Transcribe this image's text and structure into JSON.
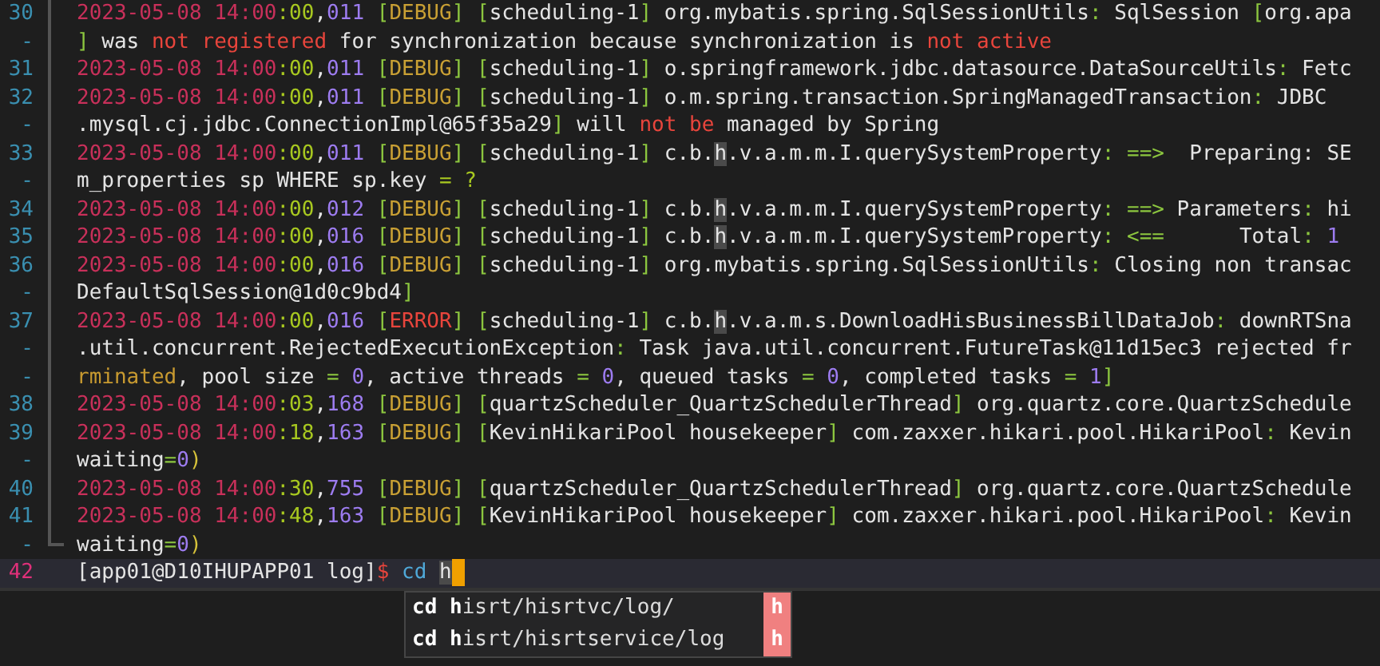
{
  "terminal": {
    "rows": [
      {
        "number": "30",
        "current": false,
        "segments": [
          {
            "kind": "date",
            "text": "2023-05-08 14:00"
          },
          {
            "kind": "sec",
            "text": ":00"
          },
          {
            "kind": "text",
            "text": ","
          },
          {
            "kind": "num",
            "text": "011"
          },
          {
            "kind": "br",
            "text": " ["
          },
          {
            "kind": "level",
            "text": "DEBUG"
          },
          {
            "kind": "br",
            "text": "]"
          },
          {
            "kind": "br",
            "text": " ["
          },
          {
            "kind": "text",
            "text": "scheduling-1"
          },
          {
            "kind": "br",
            "text": "]"
          },
          {
            "kind": "text",
            "text": " org.mybatis.spring.SqlSessionUtils"
          },
          {
            "kind": "br",
            "text": ":"
          },
          {
            "kind": "text",
            "text": " SqlSession"
          },
          {
            "kind": "br",
            "text": " ["
          },
          {
            "kind": "text",
            "text": "org.apa"
          }
        ]
      },
      {
        "number": "-",
        "current": false,
        "segments": [
          {
            "kind": "br",
            "text": "]"
          },
          {
            "kind": "text",
            "text": " was"
          },
          {
            "kind": "kw",
            "text": " not registered"
          },
          {
            "kind": "text",
            "text": " for synchronization because synchronization is"
          },
          {
            "kind": "kw",
            "text": " not active"
          }
        ]
      },
      {
        "number": "31",
        "current": false,
        "segments": [
          {
            "kind": "date",
            "text": "2023-05-08 14:00"
          },
          {
            "kind": "sec",
            "text": ":00"
          },
          {
            "kind": "text",
            "text": ","
          },
          {
            "kind": "num",
            "text": "011"
          },
          {
            "kind": "br",
            "text": " ["
          },
          {
            "kind": "level",
            "text": "DEBUG"
          },
          {
            "kind": "br",
            "text": "]"
          },
          {
            "kind": "br",
            "text": " ["
          },
          {
            "kind": "text",
            "text": "scheduling-1"
          },
          {
            "kind": "br",
            "text": "]"
          },
          {
            "kind": "text",
            "text": " o.springframework.jdbc.datasource.DataSourceUtils"
          },
          {
            "kind": "br",
            "text": ":"
          },
          {
            "kind": "text",
            "text": " Fetc"
          }
        ]
      },
      {
        "number": "32",
        "current": false,
        "segments": [
          {
            "kind": "date",
            "text": "2023-05-08 14:00"
          },
          {
            "kind": "sec",
            "text": ":00"
          },
          {
            "kind": "text",
            "text": ","
          },
          {
            "kind": "num",
            "text": "011"
          },
          {
            "kind": "br",
            "text": " ["
          },
          {
            "kind": "level",
            "text": "DEBUG"
          },
          {
            "kind": "br",
            "text": "]"
          },
          {
            "kind": "br",
            "text": " ["
          },
          {
            "kind": "text",
            "text": "scheduling-1"
          },
          {
            "kind": "br",
            "text": "]"
          },
          {
            "kind": "text",
            "text": " o.m.spring.transaction.SpringManagedTransaction"
          },
          {
            "kind": "br",
            "text": ":"
          },
          {
            "kind": "text",
            "text": " JDBC"
          }
        ]
      },
      {
        "number": "-",
        "current": false,
        "segments": [
          {
            "kind": "text",
            "text": ".mysql.cj.jdbc.ConnectionImpl@65f35a29"
          },
          {
            "kind": "br",
            "text": "]"
          },
          {
            "kind": "text",
            "text": " will"
          },
          {
            "kind": "kw",
            "text": " not be"
          },
          {
            "kind": "text",
            "text": " managed by Spring"
          }
        ]
      },
      {
        "number": "33",
        "current": false,
        "segments": [
          {
            "kind": "date",
            "text": "2023-05-08 14:00"
          },
          {
            "kind": "sec",
            "text": ":00"
          },
          {
            "kind": "text",
            "text": ","
          },
          {
            "kind": "num",
            "text": "011"
          },
          {
            "kind": "br",
            "text": " ["
          },
          {
            "kind": "level",
            "text": "DEBUG"
          },
          {
            "kind": "br",
            "text": "]"
          },
          {
            "kind": "br",
            "text": " ["
          },
          {
            "kind": "text",
            "text": "scheduling-1"
          },
          {
            "kind": "br",
            "text": "]"
          },
          {
            "kind": "text",
            "text": " c.b."
          },
          {
            "kind": "hl",
            "text": "h"
          },
          {
            "kind": "text",
            "text": ".v.a.m.m.I.querySystemProperty"
          },
          {
            "kind": "br",
            "text": ": ==>"
          },
          {
            "kind": "text",
            "text": "  Preparing: SE"
          }
        ]
      },
      {
        "number": "-",
        "current": false,
        "segments": [
          {
            "kind": "text",
            "text": "m_properties sp WHERE sp.key"
          },
          {
            "kind": "sec",
            "text": " = ?"
          }
        ]
      },
      {
        "number": "34",
        "current": false,
        "segments": [
          {
            "kind": "date",
            "text": "2023-05-08 14:00"
          },
          {
            "kind": "sec",
            "text": ":00"
          },
          {
            "kind": "text",
            "text": ","
          },
          {
            "kind": "num",
            "text": "012"
          },
          {
            "kind": "br",
            "text": " ["
          },
          {
            "kind": "level",
            "text": "DEBUG"
          },
          {
            "kind": "br",
            "text": "]"
          },
          {
            "kind": "br",
            "text": " ["
          },
          {
            "kind": "text",
            "text": "scheduling-1"
          },
          {
            "kind": "br",
            "text": "]"
          },
          {
            "kind": "text",
            "text": " c.b."
          },
          {
            "kind": "hl",
            "text": "h"
          },
          {
            "kind": "text",
            "text": ".v.a.m.m.I.querySystemProperty"
          },
          {
            "kind": "br",
            "text": ": ==>"
          },
          {
            "kind": "text",
            "text": " Parameters"
          },
          {
            "kind": "br",
            "text": ":"
          },
          {
            "kind": "text",
            "text": " hi"
          }
        ]
      },
      {
        "number": "35",
        "current": false,
        "segments": [
          {
            "kind": "date",
            "text": "2023-05-08 14:00"
          },
          {
            "kind": "sec",
            "text": ":00"
          },
          {
            "kind": "text",
            "text": ","
          },
          {
            "kind": "num",
            "text": "016"
          },
          {
            "kind": "br",
            "text": " ["
          },
          {
            "kind": "level",
            "text": "DEBUG"
          },
          {
            "kind": "br",
            "text": "]"
          },
          {
            "kind": "br",
            "text": " ["
          },
          {
            "kind": "text",
            "text": "scheduling-1"
          },
          {
            "kind": "br",
            "text": "]"
          },
          {
            "kind": "text",
            "text": " c.b."
          },
          {
            "kind": "hl",
            "text": "h"
          },
          {
            "kind": "text",
            "text": ".v.a.m.m.I.querySystemProperty"
          },
          {
            "kind": "br",
            "text": ": <=="
          },
          {
            "kind": "text",
            "text": "      Total"
          },
          {
            "kind": "br",
            "text": ":"
          },
          {
            "kind": "num",
            "text": " 1"
          }
        ]
      },
      {
        "number": "36",
        "current": false,
        "segments": [
          {
            "kind": "date",
            "text": "2023-05-08 14:00"
          },
          {
            "kind": "sec",
            "text": ":00"
          },
          {
            "kind": "text",
            "text": ","
          },
          {
            "kind": "num",
            "text": "016"
          },
          {
            "kind": "br",
            "text": " ["
          },
          {
            "kind": "level",
            "text": "DEBUG"
          },
          {
            "kind": "br",
            "text": "]"
          },
          {
            "kind": "br",
            "text": " ["
          },
          {
            "kind": "text",
            "text": "scheduling-1"
          },
          {
            "kind": "br",
            "text": "]"
          },
          {
            "kind": "text",
            "text": " org.mybatis.spring.SqlSessionUtils"
          },
          {
            "kind": "br",
            "text": ":"
          },
          {
            "kind": "text",
            "text": " Closing non transac"
          }
        ]
      },
      {
        "number": "-",
        "current": false,
        "segments": [
          {
            "kind": "text",
            "text": "DefaultSqlSession@1d0c9bd4"
          },
          {
            "kind": "br",
            "text": "]"
          }
        ]
      },
      {
        "number": "37",
        "current": false,
        "segments": [
          {
            "kind": "date",
            "text": "2023-05-08 14:00"
          },
          {
            "kind": "sec",
            "text": ":00"
          },
          {
            "kind": "text",
            "text": ","
          },
          {
            "kind": "num",
            "text": "016"
          },
          {
            "kind": "br",
            "text": " ["
          },
          {
            "kind": "error",
            "text": "ERROR"
          },
          {
            "kind": "br",
            "text": "]"
          },
          {
            "kind": "br",
            "text": " ["
          },
          {
            "kind": "text",
            "text": "scheduling-1"
          },
          {
            "kind": "br",
            "text": "]"
          },
          {
            "kind": "text",
            "text": " c.b."
          },
          {
            "kind": "hl",
            "text": "h"
          },
          {
            "kind": "text",
            "text": ".v.a.m.s.DownloadHisBusinessBillDataJob"
          },
          {
            "kind": "br",
            "text": ":"
          },
          {
            "kind": "text",
            "text": " downRTSna"
          }
        ]
      },
      {
        "number": "-",
        "current": false,
        "segments": [
          {
            "kind": "text",
            "text": ".util.concurrent.RejectedExecutionException"
          },
          {
            "kind": "br",
            "text": ":"
          },
          {
            "kind": "text",
            "text": " Task java.util.concurrent.FutureTask@11d15ec3 rejected fr"
          }
        ]
      },
      {
        "number": "-",
        "current": false,
        "segments": [
          {
            "kind": "warn",
            "text": "rminated"
          },
          {
            "kind": "text",
            "text": ", pool size"
          },
          {
            "kind": "br",
            "text": " ="
          },
          {
            "kind": "num",
            "text": " 0"
          },
          {
            "kind": "text",
            "text": ", active threads"
          },
          {
            "kind": "br",
            "text": " ="
          },
          {
            "kind": "num",
            "text": " 0"
          },
          {
            "kind": "text",
            "text": ", queued tasks"
          },
          {
            "kind": "br",
            "text": " ="
          },
          {
            "kind": "num",
            "text": " 0"
          },
          {
            "kind": "text",
            "text": ", completed tasks"
          },
          {
            "kind": "br",
            "text": " ="
          },
          {
            "kind": "num",
            "text": " 1"
          },
          {
            "kind": "br",
            "text": "]"
          }
        ]
      },
      {
        "number": "38",
        "current": false,
        "segments": [
          {
            "kind": "date",
            "text": "2023-05-08 14:00"
          },
          {
            "kind": "sec",
            "text": ":03"
          },
          {
            "kind": "text",
            "text": ","
          },
          {
            "kind": "num",
            "text": "168"
          },
          {
            "kind": "br",
            "text": " ["
          },
          {
            "kind": "level",
            "text": "DEBUG"
          },
          {
            "kind": "br",
            "text": "]"
          },
          {
            "kind": "br",
            "text": " ["
          },
          {
            "kind": "text",
            "text": "quartzScheduler_QuartzSchedulerThread"
          },
          {
            "kind": "br",
            "text": "]"
          },
          {
            "kind": "text",
            "text": " org.quartz.core.QuartzSchedule"
          }
        ]
      },
      {
        "number": "39",
        "current": false,
        "segments": [
          {
            "kind": "date",
            "text": "2023-05-08 14:00"
          },
          {
            "kind": "sec",
            "text": ":18"
          },
          {
            "kind": "text",
            "text": ","
          },
          {
            "kind": "num",
            "text": "163"
          },
          {
            "kind": "br",
            "text": " ["
          },
          {
            "kind": "level",
            "text": "DEBUG"
          },
          {
            "kind": "br",
            "text": "]"
          },
          {
            "kind": "br",
            "text": " ["
          },
          {
            "kind": "text",
            "text": "KevinHikariPool housekeeper"
          },
          {
            "kind": "br",
            "text": "]"
          },
          {
            "kind": "text",
            "text": " com.zaxxer.hikari.pool.HikariPool"
          },
          {
            "kind": "br",
            "text": ":"
          },
          {
            "kind": "text",
            "text": " Kevin"
          }
        ]
      },
      {
        "number": "-",
        "current": false,
        "segments": [
          {
            "kind": "text",
            "text": "waiting"
          },
          {
            "kind": "br",
            "text": "="
          },
          {
            "kind": "num",
            "text": "0"
          },
          {
            "kind": "paren",
            "text": ")"
          }
        ]
      },
      {
        "number": "40",
        "current": false,
        "segments": [
          {
            "kind": "date",
            "text": "2023-05-08 14:00"
          },
          {
            "kind": "sec",
            "text": ":30"
          },
          {
            "kind": "text",
            "text": ","
          },
          {
            "kind": "num",
            "text": "755"
          },
          {
            "kind": "br",
            "text": " ["
          },
          {
            "kind": "level",
            "text": "DEBUG"
          },
          {
            "kind": "br",
            "text": "]"
          },
          {
            "kind": "br",
            "text": " ["
          },
          {
            "kind": "text",
            "text": "quartzScheduler_QuartzSchedulerThread"
          },
          {
            "kind": "br",
            "text": "]"
          },
          {
            "kind": "text",
            "text": " org.quartz.core.QuartzSchedule"
          }
        ]
      },
      {
        "number": "41",
        "current": false,
        "segments": [
          {
            "kind": "date",
            "text": "2023-05-08 14:00"
          },
          {
            "kind": "sec",
            "text": ":48"
          },
          {
            "kind": "text",
            "text": ","
          },
          {
            "kind": "num",
            "text": "163"
          },
          {
            "kind": "br",
            "text": " ["
          },
          {
            "kind": "level",
            "text": "DEBUG"
          },
          {
            "kind": "br",
            "text": "]"
          },
          {
            "kind": "br",
            "text": " ["
          },
          {
            "kind": "text",
            "text": "KevinHikariPool housekeeper"
          },
          {
            "kind": "br",
            "text": "]"
          },
          {
            "kind": "text",
            "text": " com.zaxxer.hikari.pool.HikariPool"
          },
          {
            "kind": "br",
            "text": ":"
          },
          {
            "kind": "text",
            "text": " Kevin"
          }
        ]
      },
      {
        "number": "-",
        "current": false,
        "segments": [
          {
            "kind": "text",
            "text": "waiting"
          },
          {
            "kind": "br",
            "text": "="
          },
          {
            "kind": "num",
            "text": "0"
          },
          {
            "kind": "paren",
            "text": ")"
          }
        ]
      },
      {
        "number": "42",
        "current": true,
        "segments": [
          {
            "kind": "text",
            "text": "[app01@D10IHUPAPP01 log]"
          },
          {
            "kind": "kw",
            "text": "$"
          },
          {
            "kind": "cmd",
            "text": " cd "
          },
          {
            "kind": "hl",
            "text": "h"
          }
        ]
      }
    ]
  },
  "suggestions": [
    {
      "label": "**cd** **h**isrt/hisrtvc/log/",
      "badge": "h"
    },
    {
      "label": "**cd** **h**isrt/hisrtservice/log",
      "badge": "h"
    }
  ]
}
